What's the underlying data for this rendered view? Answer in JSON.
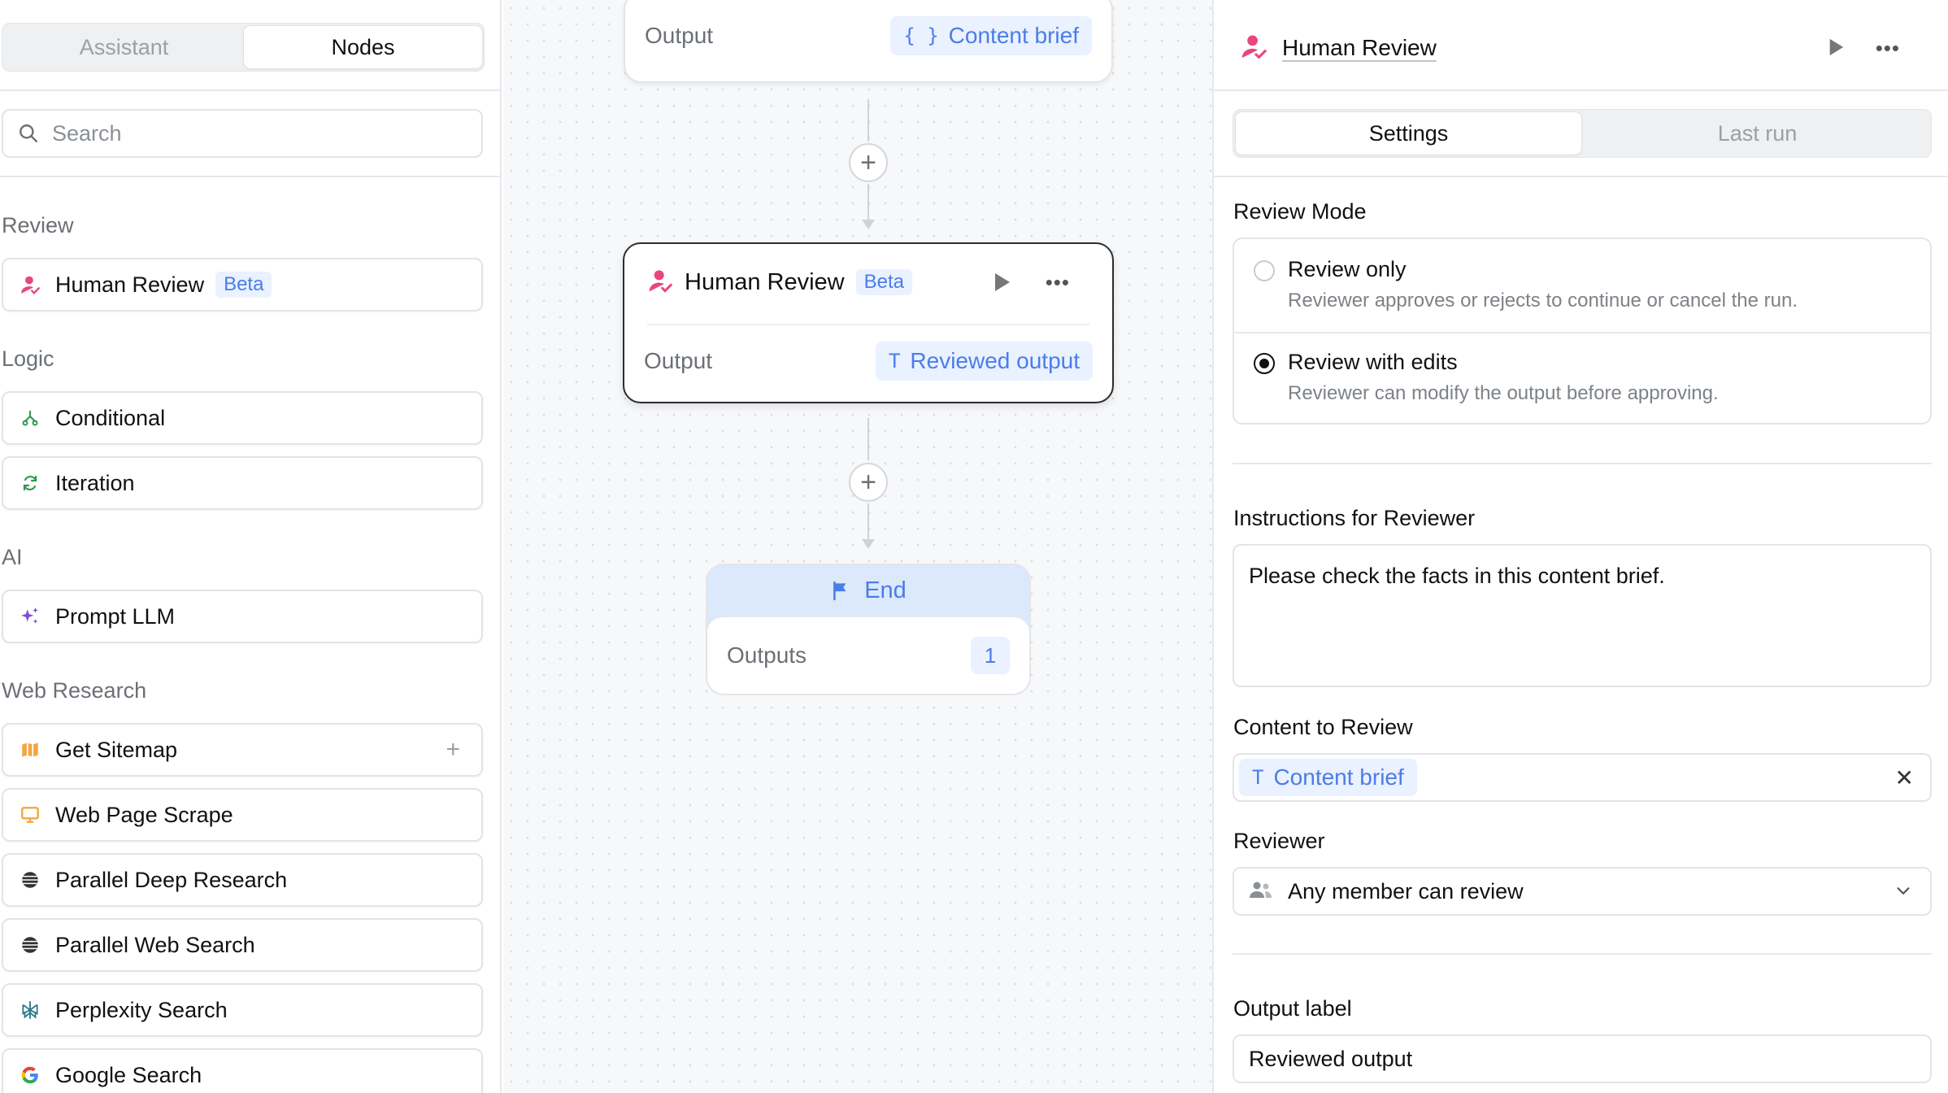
{
  "left_panel": {
    "tabs": [
      "Assistant",
      "Nodes"
    ],
    "active_tab": "Nodes",
    "search": {
      "placeholder": "Search",
      "value": ""
    },
    "sections": [
      {
        "title": "Review",
        "items": [
          {
            "label": "Human Review",
            "badge": "Beta",
            "icon": "person-review-icon"
          }
        ]
      },
      {
        "title": "Logic",
        "items": [
          {
            "label": "Conditional",
            "icon": "branch-icon"
          },
          {
            "label": "Iteration",
            "icon": "loop-icon"
          }
        ]
      },
      {
        "title": "AI",
        "items": [
          {
            "label": "Prompt LLM",
            "icon": "sparkle-icon"
          }
        ]
      },
      {
        "title": "Web Research",
        "items": [
          {
            "label": "Get Sitemap",
            "icon": "map-icon"
          },
          {
            "label": "Web Page Scrape",
            "icon": "monitor-icon"
          },
          {
            "label": "Parallel Deep Research",
            "icon": "parallel-icon"
          },
          {
            "label": "Parallel Web Search",
            "icon": "parallel-icon"
          },
          {
            "label": "Perplexity Search",
            "icon": "perplexity-icon"
          },
          {
            "label": "Google Search",
            "icon": "google-icon"
          }
        ]
      }
    ]
  },
  "canvas": {
    "top_node": {
      "output_label": "Output",
      "output_value": "Content brief",
      "output_glyph": "{ }"
    },
    "review_node": {
      "title": "Human Review",
      "badge": "Beta",
      "output_label": "Output",
      "output_value": "Reviewed output",
      "output_glyph": "T"
    },
    "end_node": {
      "title": "End",
      "outputs_label": "Outputs",
      "outputs_count": "1"
    },
    "add_glyph": "+",
    "more_glyph": "•••"
  },
  "right_panel": {
    "title": "Human Review",
    "more_glyph": "•••",
    "tabs": [
      "Settings",
      "Last run"
    ],
    "active_tab": "Settings",
    "review_mode": {
      "label": "Review Mode",
      "options": [
        {
          "title": "Review only",
          "description": "Reviewer approves or rejects to continue or cancel the run.",
          "selected": false
        },
        {
          "title": "Review with edits",
          "description": "Reviewer can modify the output before approving.",
          "selected": true
        }
      ]
    },
    "instructions": {
      "label": "Instructions for Reviewer",
      "value": "Please check the facts in this content brief."
    },
    "content_to_review": {
      "label": "Content to Review",
      "chip": "Content brief",
      "chip_glyph": "T",
      "clear_glyph": "✕"
    },
    "reviewer": {
      "label": "Reviewer",
      "value": "Any member can review"
    },
    "output_label": {
      "label": "Output label",
      "value": "Reviewed output"
    }
  },
  "colors": {
    "accent_blue": "#4a7de8",
    "chip_bg": "#eaf1ff",
    "review_pink": "#e8467c",
    "border": "#e1e4e8"
  }
}
